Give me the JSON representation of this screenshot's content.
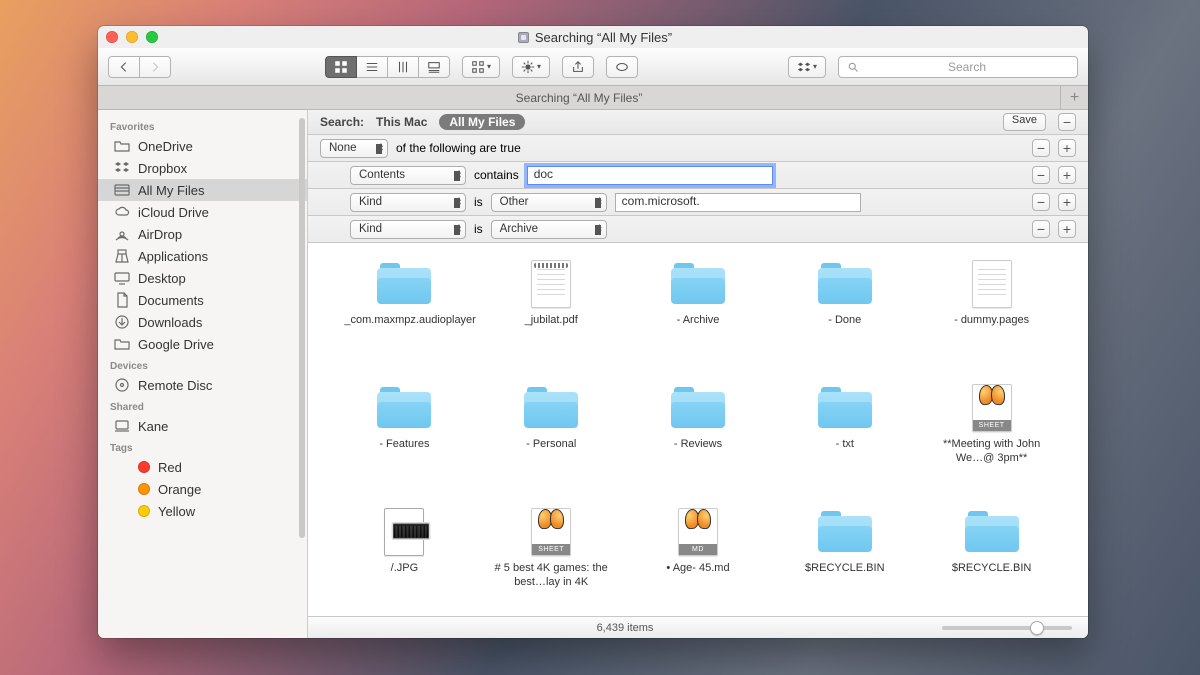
{
  "window": {
    "title": "Searching “All My Files”"
  },
  "toolbar": {
    "search_placeholder": "Search"
  },
  "tab": {
    "title": "Searching “All My Files”"
  },
  "sidebar": {
    "favorites_label": "Favorites",
    "favorites": [
      {
        "icon": "folder",
        "label": "OneDrive"
      },
      {
        "icon": "dropbox",
        "label": "Dropbox"
      },
      {
        "icon": "allfiles",
        "label": "All My Files",
        "selected": true
      },
      {
        "icon": "cloud",
        "label": "iCloud Drive"
      },
      {
        "icon": "airdrop",
        "label": "AirDrop"
      },
      {
        "icon": "apps",
        "label": "Applications"
      },
      {
        "icon": "desktop",
        "label": "Desktop"
      },
      {
        "icon": "docs",
        "label": "Documents"
      },
      {
        "icon": "downloads",
        "label": "Downloads"
      },
      {
        "icon": "folder",
        "label": "Google Drive"
      }
    ],
    "devices_label": "Devices",
    "devices": [
      {
        "icon": "disc",
        "label": "Remote Disc"
      }
    ],
    "shared_label": "Shared",
    "shared": [
      {
        "icon": "computer",
        "label": "Kane"
      }
    ],
    "tags_label": "Tags",
    "tags": [
      {
        "color": "#ff3b30",
        "label": "Red"
      },
      {
        "color": "#ff9500",
        "label": "Orange"
      },
      {
        "color": "#ffcc00",
        "label": "Yellow"
      }
    ]
  },
  "scope": {
    "label": "Search:",
    "this_mac": "This Mac",
    "all_files": "All My Files",
    "save": "Save"
  },
  "criteria": {
    "row0": {
      "select": "None",
      "rest": "of the following are true"
    },
    "row1": {
      "select": "Contents",
      "pred": "contains",
      "value": "doc"
    },
    "row2": {
      "select": "Kind",
      "pred": "is",
      "kind": "Other",
      "value": "com.microsoft."
    },
    "row3": {
      "select": "Kind",
      "pred": "is",
      "kind": "Archive"
    }
  },
  "files": [
    {
      "type": "folder",
      "name": "_com.maxmpz.audioplayer"
    },
    {
      "type": "pdf",
      "name": "_jubilat.pdf"
    },
    {
      "type": "folder",
      "name": "- Archive"
    },
    {
      "type": "folder",
      "name": "- Done"
    },
    {
      "type": "pages",
      "name": "- dummy.pages"
    },
    {
      "type": "folder",
      "name": "- Features"
    },
    {
      "type": "folder",
      "name": "- Personal"
    },
    {
      "type": "folder",
      "name": "- Reviews"
    },
    {
      "type": "folder",
      "name": "- txt"
    },
    {
      "type": "sheet",
      "name": "**Meeting with John We…@ 3pm**"
    },
    {
      "type": "jpg",
      "name": "/.JPG"
    },
    {
      "type": "sheet",
      "name": "# 5 best 4K games: the best…lay in 4K"
    },
    {
      "type": "md",
      "name": "• Age- 45.md"
    },
    {
      "type": "folder",
      "name": "$RECYCLE.BIN"
    },
    {
      "type": "folder",
      "name": "$RECYCLE.BIN"
    }
  ],
  "status": {
    "count": "6,439 items"
  }
}
